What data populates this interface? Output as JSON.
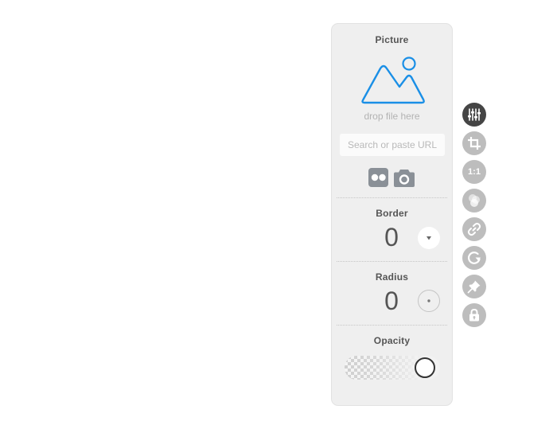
{
  "picture": {
    "title": "Picture",
    "drop_text": "drop file here",
    "url_placeholder": "Search or paste URL",
    "image_icon": "mountain-image-icon",
    "sources": [
      {
        "name": "flickr-icon"
      },
      {
        "name": "camera-icon"
      }
    ]
  },
  "border": {
    "title": "Border",
    "value": "0",
    "control_icon": "triangle-down-icon"
  },
  "radius": {
    "title": "Radius",
    "value": "0",
    "control_icon": "dot-icon"
  },
  "opacity": {
    "title": "Opacity",
    "level": 1.0
  },
  "toolbar": {
    "ratio_label": "1:1",
    "items": [
      {
        "icon": "sliders-icon",
        "active": true
      },
      {
        "icon": "crop-icon",
        "active": false
      },
      {
        "icon": "aspect-ratio-icon",
        "active": false
      },
      {
        "icon": "color-blend-icon",
        "active": false
      },
      {
        "icon": "link-icon",
        "active": false
      },
      {
        "icon": "rotate-icon",
        "active": false
      },
      {
        "icon": "pin-icon",
        "active": false
      },
      {
        "icon": "lock-icon",
        "active": false
      }
    ]
  },
  "colors": {
    "accent": "#1a8fe6",
    "panel_bg": "#efefef",
    "active_tool": "#454545",
    "inactive_tool": "#bdbdbd"
  }
}
